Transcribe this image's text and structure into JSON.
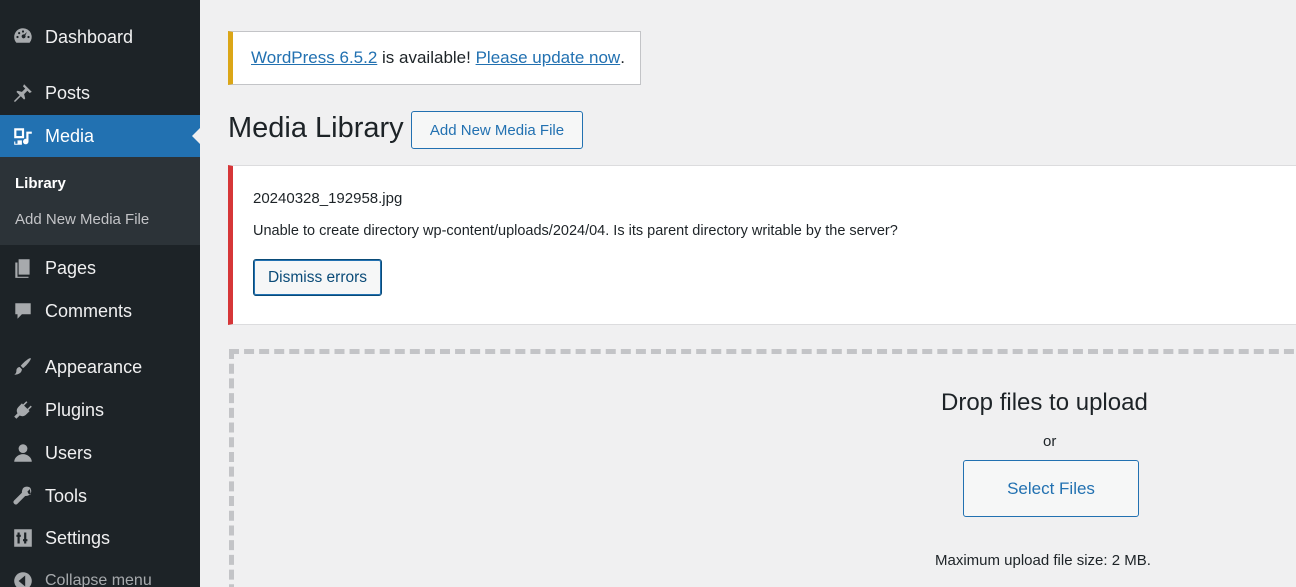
{
  "sidebar": {
    "items": [
      {
        "name": "dashboard",
        "label": "Dashboard",
        "icon": "dashboard-icon"
      },
      {
        "name": "posts",
        "label": "Posts",
        "icon": "pin-icon"
      },
      {
        "name": "media",
        "label": "Media",
        "icon": "media-icon"
      },
      {
        "name": "pages",
        "label": "Pages",
        "icon": "pages-icon"
      },
      {
        "name": "comments",
        "label": "Comments",
        "icon": "comment-icon"
      },
      {
        "name": "appearance",
        "label": "Appearance",
        "icon": "paintbrush-icon"
      },
      {
        "name": "plugins",
        "label": "Plugins",
        "icon": "plug-icon"
      },
      {
        "name": "users",
        "label": "Users",
        "icon": "user-icon"
      },
      {
        "name": "tools",
        "label": "Tools",
        "icon": "wrench-icon"
      },
      {
        "name": "settings",
        "label": "Settings",
        "icon": "settings-sliders-icon"
      }
    ],
    "submenu": {
      "library": "Library",
      "add_new": "Add New Media File"
    },
    "collapse_label": "Collapse menu",
    "active_color": "#2271b1"
  },
  "update_notice": {
    "version_link": "WordPress 6.5.2",
    "middle_text": " is available! ",
    "update_link": "Please update now",
    "end_text": "."
  },
  "header": {
    "title": "Media Library",
    "add_button": "Add New Media File"
  },
  "error": {
    "filename": "20240328_192958.jpg",
    "message": "Unable to create directory wp-content/uploads/2024/04. Is its parent directory writable by the server?",
    "dismiss_button": "Dismiss errors"
  },
  "uploader": {
    "title": "Drop files to upload",
    "or": "or",
    "select_button": "Select Files",
    "max_size": "Maximum upload file size: 2 MB."
  }
}
